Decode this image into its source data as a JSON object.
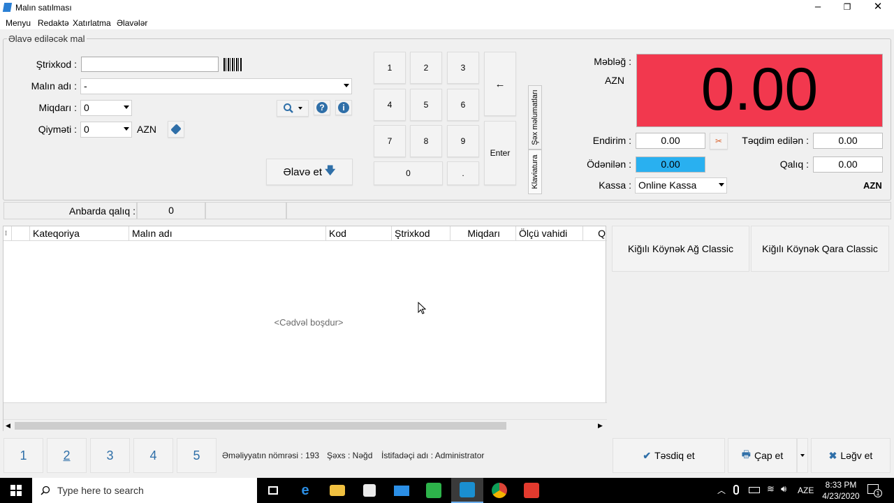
{
  "window": {
    "title": "Malın satılması"
  },
  "menu": [
    "Menyu",
    "Redaktə",
    "Xatırlatma",
    "Əlavələr"
  ],
  "group_title": "Əlavə ediləcək mal",
  "form": {
    "barcode_label": "Ştrixkod :",
    "barcode_value": "",
    "name_label": "Malın adı :",
    "name_value": "-",
    "qty_label": "Miqdarı :",
    "qty_value": "0",
    "price_label": "Qiyməti :",
    "price_value": "0",
    "currency": "AZN",
    "add_button": "Əlavə et"
  },
  "keypad": {
    "keys": [
      "1",
      "2",
      "3",
      "4",
      "5",
      "6",
      "7",
      "8",
      "9",
      "0",
      "."
    ],
    "backspace": "←",
    "enter": "Enter"
  },
  "side_tabs": {
    "tab_person": "Şəx məlumatları",
    "tab_keyboard": "Klaviatura"
  },
  "summary": {
    "amount_label": "Məbləğ :",
    "amount_currency": "AZN",
    "amount_value": "0.00",
    "amount_color": "#f2384e",
    "discount_label": "Endirim :",
    "discount_value": "0.00",
    "tendered_label": "Təqdim edilən :",
    "tendered_value": "0.00",
    "paid_label": "Ödənilən :",
    "paid_value": "0.00",
    "paid_color": "#29b0f0",
    "change_label": "Qalıq :",
    "change_value": "0.00",
    "register_label": "Kassa :",
    "register_value": "Online Kassa",
    "currency": "AZN"
  },
  "stock": {
    "label": "Anbarda qalıq :",
    "value": "0"
  },
  "grid": {
    "columns": [
      "Kateqoriya",
      "Malın adı",
      "Kod",
      "Ştrixkod",
      "Miqdarı",
      "Ölçü vahidi",
      "Q"
    ],
    "empty_text": "<Cədvəl boşdur>"
  },
  "products": [
    "Kiğılı Köynək Ağ Classic",
    "Kiğılı Köynək Qara Classic"
  ],
  "pages": [
    "1",
    "2",
    "3",
    "4",
    "5"
  ],
  "status": {
    "operation": "Əməliyyatın nömrəsi : 193",
    "person": "Şəxs : Nəğd",
    "user": "İstifadəçi adı : Administrator"
  },
  "actions": {
    "confirm": "Təsdiq et",
    "print": "Çap et",
    "cancel": "Ləğv et"
  },
  "taskbar": {
    "search_placeholder": "Type here to search",
    "language": "AZE",
    "time": "8:33 PM",
    "date": "4/23/2020",
    "notification_count": "1"
  }
}
